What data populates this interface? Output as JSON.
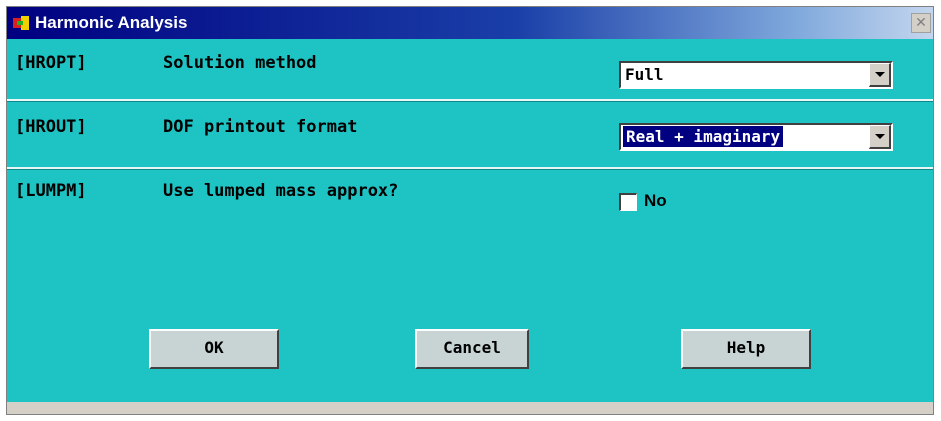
{
  "window": {
    "title": "Harmonic Analysis",
    "close_glyph": "✕"
  },
  "rows": [
    {
      "tag": "[HROPT]",
      "label": "Solution method",
      "value": "Full"
    },
    {
      "tag": "[HROUT]",
      "label": "DOF printout format",
      "value": "Real + imaginary"
    },
    {
      "tag": "[LUMPM]",
      "label": "Use lumped mass approx?",
      "checkbox_label": "No",
      "checked": false
    }
  ],
  "buttons": {
    "ok": "OK",
    "cancel": "Cancel",
    "help": "Help"
  },
  "colors": {
    "panel_bg": "#1ec4c4",
    "title_bar": "#000080"
  },
  "icons": [
    "app-icon",
    "close-icon",
    "dropdown-arrow-icon"
  ]
}
